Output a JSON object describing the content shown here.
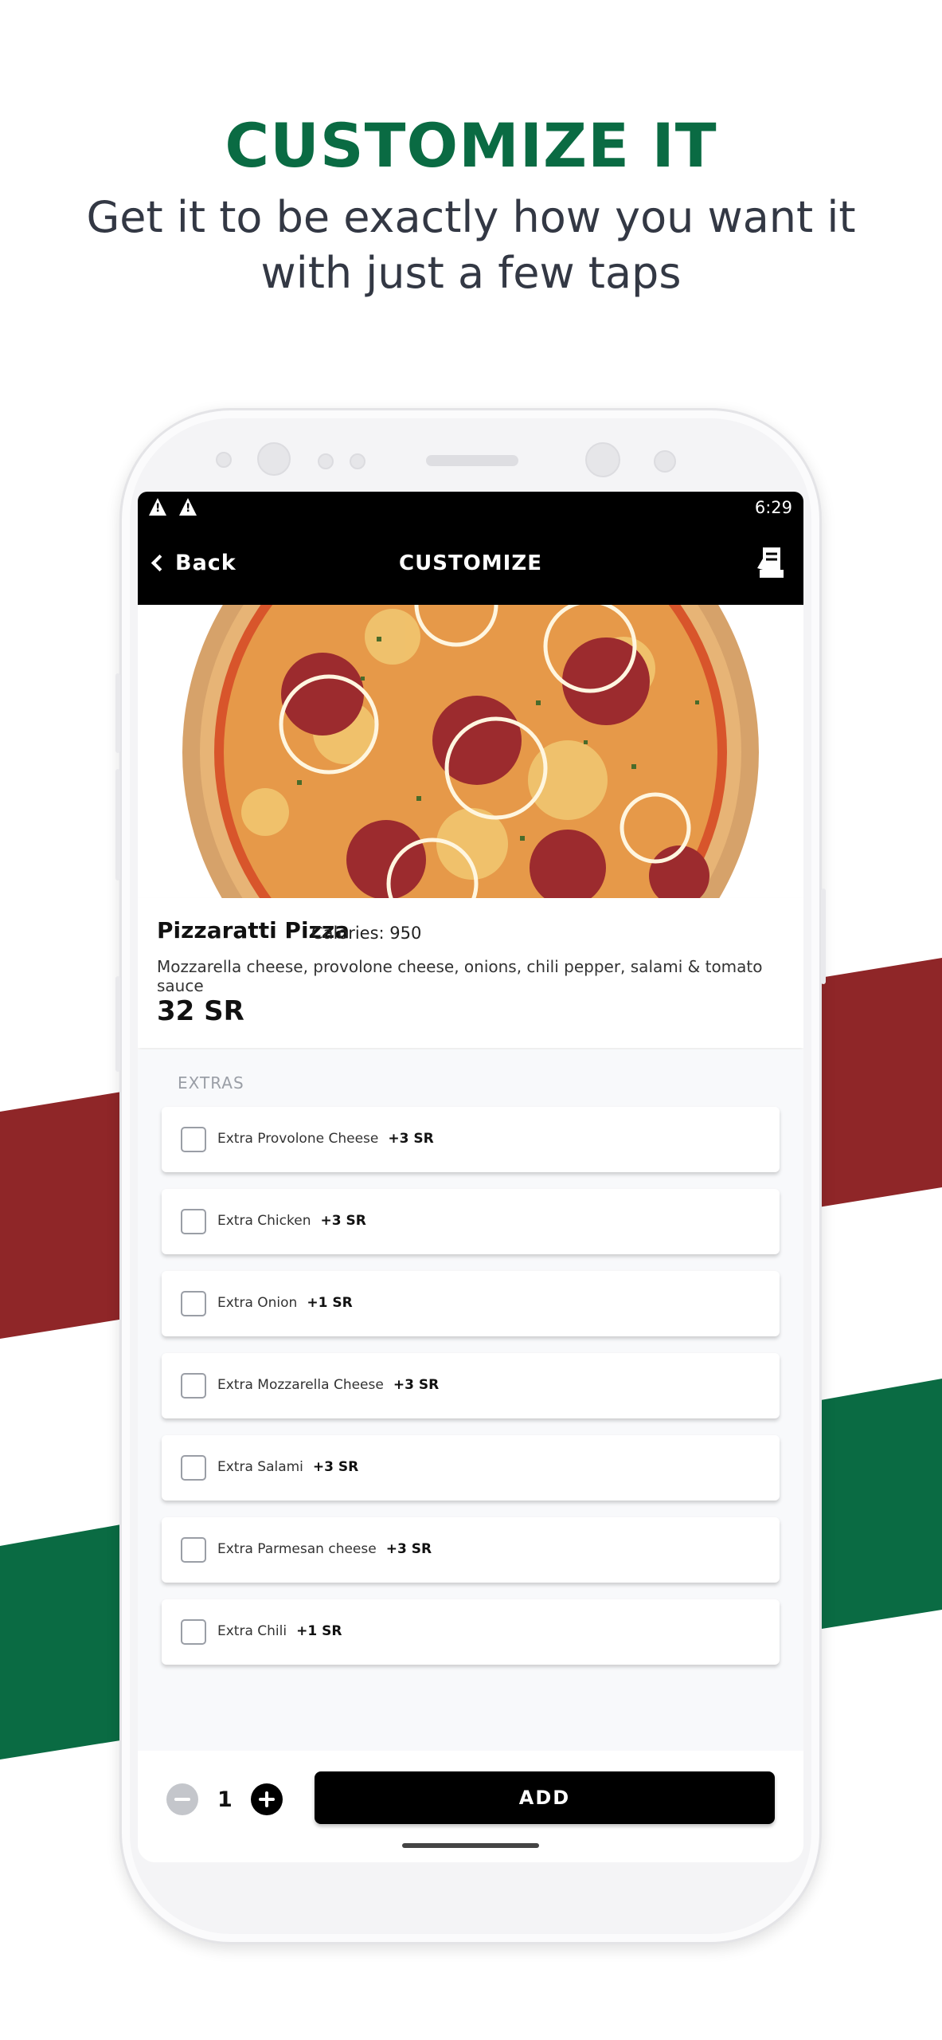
{
  "promo": {
    "title": "CUSTOMIZE IT",
    "subtitle_line1": "Get it to be exactly how you want it",
    "subtitle_line2": "with just a few taps"
  },
  "colors": {
    "brand_green": "#0a6b43",
    "brand_red": "#8f2628",
    "nav_bg": "#000000"
  },
  "status_bar": {
    "time": "6:29",
    "icons": [
      "warning-icon",
      "warning-icon"
    ]
  },
  "nav": {
    "back_label": "Back",
    "title": "CUSTOMIZE",
    "cart_icon": "cart-icon"
  },
  "product": {
    "name": "Pizzaratti Pizza",
    "calories": "Calories: 950",
    "description": "Mozzarella cheese, provolone cheese, onions, chili pepper, salami & tomato sauce",
    "price": "32 SR"
  },
  "extras": {
    "title": "EXTRAS",
    "items": [
      {
        "name": "Extra Provolone Cheese",
        "price": "+3 SR"
      },
      {
        "name": "Extra Chicken",
        "price": "+3 SR"
      },
      {
        "name": "Extra Onion",
        "price": "+1 SR"
      },
      {
        "name": "Extra Mozzarella Cheese",
        "price": "+3 SR"
      },
      {
        "name": "Extra Salami",
        "price": "+3 SR"
      },
      {
        "name": "Extra Parmesan cheese",
        "price": "+3 SR"
      },
      {
        "name": "Extra Chili",
        "price": "+1 SR"
      }
    ]
  },
  "order": {
    "quantity": "1",
    "add_label": "ADD"
  }
}
